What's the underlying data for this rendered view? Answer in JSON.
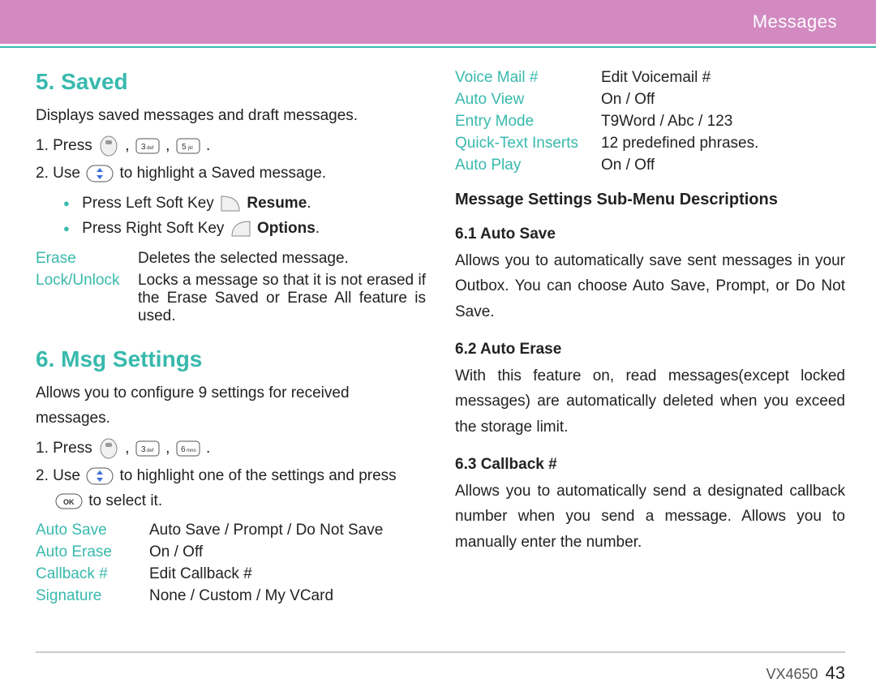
{
  "header": {
    "section": "Messages"
  },
  "left": {
    "saved": {
      "title": "5. Saved",
      "intro": "Displays saved messages and draft messages.",
      "step1_pre": "1.  Press ",
      "step2_pre": "2.  Use ",
      "step2_post": " to highlight a Saved message.",
      "bullet1_pre": "Press Left Soft Key ",
      "bullet1_bold": "Resume",
      "bullet2_pre": "Press Right Soft Key ",
      "bullet2_bold": "Options",
      "erase_term": "Erase",
      "erase_val": "Deletes the selected message.",
      "lock_term": "Lock/Unlock",
      "lock_val": "Locks a message so that it is not erased if the Erase Saved or Erase All feature is used."
    },
    "msg": {
      "title": "6. Msg Settings",
      "intro": "Allows you to configure 9 settings for received messages.",
      "step1_pre": "1.  Press ",
      "step2_pre": "2.  Use ",
      "step2_mid": " to highlight one of the settings and press ",
      "step2_post": " to select it.",
      "rows": [
        {
          "term": "Auto Save",
          "val": "Auto Save / Prompt / Do Not Save"
        },
        {
          "term": "Auto Erase",
          "val": "On / Off"
        },
        {
          "term": "Callback #",
          "val": "Edit Callback #"
        },
        {
          "term": "Signature",
          "val": "None / Custom / My VCard"
        }
      ]
    }
  },
  "right": {
    "rows": [
      {
        "term": "Voice Mail #",
        "val": "Edit Voicemail #"
      },
      {
        "term": "Auto View",
        "val": "On / Off"
      },
      {
        "term": "Entry Mode",
        "val": "T9Word / Abc / 123"
      },
      {
        "term": "Quick-Text Inserts",
        "val": "12 predefined phrases."
      },
      {
        "term": "Auto Play",
        "val": "On / Off"
      }
    ],
    "sub_title": "Message Settings Sub-Menu Descriptions",
    "autosave": {
      "title": "6.1 Auto Save",
      "body": "Allows you to automatically save sent messages in your Outbox. You can choose Auto Save, Prompt, or Do Not Save."
    },
    "autoerase": {
      "title": "6.2 Auto Erase",
      "body": "With this feature on, read messages(except locked messages) are automatically deleted when you exceed the storage limit."
    },
    "callback": {
      "title": "6.3 Callback #",
      "body": "Allows you to automatically send a designated callback number when you send a message. Allows you to manually enter the number."
    }
  },
  "footer": {
    "model": "VX4650",
    "page": "43"
  }
}
